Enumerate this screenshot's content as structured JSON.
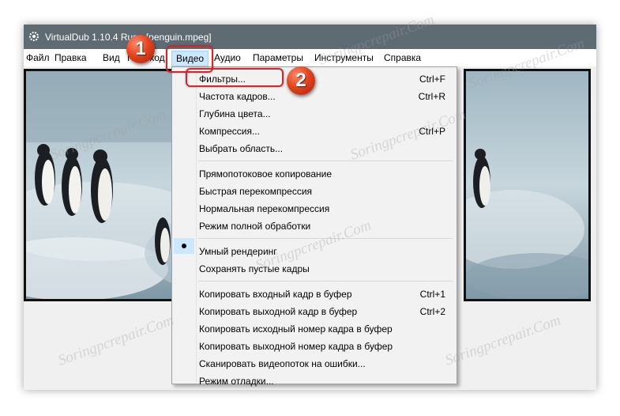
{
  "window": {
    "title": "VirtualDub 1.10.4 Rus - [penguin.mpeg]"
  },
  "menubar": {
    "items": [
      "Файл",
      "Правка",
      "Вид",
      "Переход",
      "Видео",
      "Аудио",
      "Параметры",
      "Инструменты",
      "Справка"
    ]
  },
  "dropdown": {
    "groups": [
      [
        {
          "label": "Фильтры...",
          "shortcut": "Ctrl+F"
        },
        {
          "label": "Частота кадров...",
          "shortcut": "Ctrl+R"
        },
        {
          "label": "Глубина цвета...",
          "shortcut": ""
        },
        {
          "label": "Компрессия...",
          "shortcut": "Ctrl+P"
        },
        {
          "label": "Выбрать область...",
          "shortcut": ""
        }
      ],
      [
        {
          "label": "Прямопотоковое копирование",
          "shortcut": ""
        },
        {
          "label": "Быстрая перекомпрессия",
          "shortcut": ""
        },
        {
          "label": "Нормальная перекомпрессия",
          "shortcut": ""
        },
        {
          "label": "Режим полной обработки",
          "shortcut": "",
          "checked": true
        }
      ],
      [
        {
          "label": "Умный рендеринг",
          "shortcut": ""
        },
        {
          "label": "Сохранять пустые кадры",
          "shortcut": ""
        }
      ],
      [
        {
          "label": "Копировать входный кадр в буфер",
          "shortcut": "Ctrl+1"
        },
        {
          "label": "Копировать выходной кадр в буфер",
          "shortcut": "Ctrl+2"
        },
        {
          "label": "Копировать исходный номер кадра в буфер",
          "shortcut": ""
        },
        {
          "label": "Копировать выходной номер кадра в буфер",
          "shortcut": ""
        },
        {
          "label": "Сканировать видеопоток на ошибки...",
          "shortcut": ""
        },
        {
          "label": "Режим отладки...",
          "shortcut": ""
        }
      ]
    ]
  },
  "annotations": {
    "step1": "1",
    "step2": "2"
  },
  "watermark": "Soringpcrepair.Com",
  "colors": {
    "titlebar": "#5f6b72",
    "menu_highlight": "#cce8ff",
    "annotation_red": "#d9252a"
  }
}
